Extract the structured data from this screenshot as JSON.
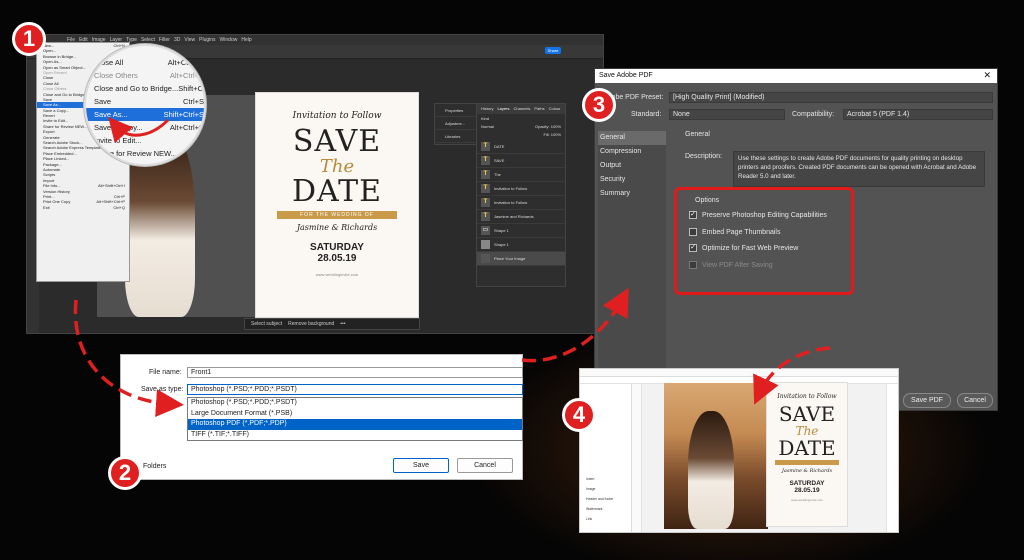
{
  "badges": [
    "1",
    "2",
    "3",
    "4"
  ],
  "accent": "#e02020",
  "ps": {
    "menus": [
      "File",
      "Edit",
      "Image",
      "Layer",
      "Type",
      "Select",
      "Filter",
      "3D",
      "View",
      "Plugins",
      "Window",
      "Help"
    ],
    "share_label": "Share",
    "task_select": "Select subject",
    "task_remove": "Remove background"
  },
  "invite": {
    "sub": "Invitation to Follow",
    "save": "SAVE",
    "the": "The",
    "date": "DATE",
    "band": "FOR THE WEDDING OF",
    "names": "Jasmine & Richards",
    "day": "SATURDAY",
    "num": "28.05.19",
    "url": "www.weddinginvite.com"
  },
  "props_panel": [
    "Properties",
    "Adjustme...",
    "Libraries"
  ],
  "layers_panel": {
    "tabs": [
      "History",
      "Layers",
      "Channels",
      "Paths",
      "Colour"
    ],
    "kind": "Kind",
    "blend": "Normal",
    "opacity": "Opacity: 100%",
    "fill": "Fill: 100%",
    "rows": [
      "DATE",
      "SAVE",
      "The",
      "Invitation to Follow",
      "Invitation to Follow",
      "Jasmine and Richards",
      "Shape 1",
      "Shape 1",
      "Place Your Image"
    ]
  },
  "file_menu": {
    "items": [
      {
        "label": "New...",
        "shortcut": "Ctrl+N"
      },
      {
        "label": "Open...",
        "shortcut": ""
      },
      {
        "label": "Browse in Bridge...",
        "shortcut": ""
      },
      {
        "label": "Open As...",
        "shortcut": ""
      },
      {
        "label": "Open as Smart Object...",
        "shortcut": ""
      },
      {
        "label": "Open Recent",
        "shortcut": ""
      },
      {
        "label": "Close",
        "shortcut": ""
      },
      {
        "label": "Close All",
        "shortcut": ""
      },
      {
        "label": "Close Others",
        "shortcut": ""
      },
      {
        "label": "Close and Go to Bridge...",
        "shortcut": ""
      },
      {
        "label": "Save",
        "shortcut": ""
      },
      {
        "label": "Save As...",
        "shortcut": ""
      },
      {
        "label": "Save a Copy...",
        "shortcut": ""
      },
      {
        "label": "Revert",
        "shortcut": ""
      },
      {
        "label": "Invite to Edit...",
        "shortcut": ""
      },
      {
        "label": "Share for Review NEW...",
        "shortcut": ""
      },
      {
        "label": "Export",
        "shortcut": ""
      },
      {
        "label": "Generate",
        "shortcut": ""
      },
      {
        "label": "Search Adobe Stock...",
        "shortcut": ""
      },
      {
        "label": "Search Adobe Express Templates...",
        "shortcut": ""
      },
      {
        "label": "Place Embedded...",
        "shortcut": ""
      },
      {
        "label": "Place Linked...",
        "shortcut": ""
      },
      {
        "label": "Package...",
        "shortcut": ""
      },
      {
        "label": "Automate",
        "shortcut": ""
      },
      {
        "label": "Scripts",
        "shortcut": ""
      },
      {
        "label": "Import",
        "shortcut": ""
      },
      {
        "label": "File Info...",
        "shortcut": "Alt+Shift+Ctrl+I"
      },
      {
        "label": "Version History",
        "shortcut": ""
      },
      {
        "label": "Print...",
        "shortcut": "Ctrl+P"
      },
      {
        "label": "Print One Copy",
        "shortcut": "Alt+Shift+Ctrl+P"
      },
      {
        "label": "Exit",
        "shortcut": "Ctrl+Q"
      }
    ]
  },
  "magnifier": {
    "items": [
      {
        "label": "Close All",
        "shortcut": "Alt+Ctrl+W"
      },
      {
        "label": "Close Others",
        "shortcut": "Alt+Ctrl+P"
      },
      {
        "label": "Close and Go to Bridge...",
        "shortcut": "Shift+Ctrl+W"
      },
      {
        "label": "Save",
        "shortcut": "Ctrl+S"
      },
      {
        "label": "Save As...",
        "shortcut": "Shift+Ctrl+S"
      },
      {
        "label": "Save a Copy...",
        "shortcut": "Alt+Ctrl+S"
      },
      {
        "label": "Invite to Edit...",
        "shortcut": ""
      },
      {
        "label": "Share for Review NEW...",
        "shortcut": ""
      }
    ]
  },
  "save_dialog": {
    "file_name_label": "File name:",
    "file_name": "Front1",
    "type_label": "Save as type:",
    "type_value": "Photoshop (*.PSD;*.PDD;*.PSDT)",
    "options": [
      "Photoshop (*.PSD;*.PDD;*.PSDT)",
      "Large Document Format (*.PSB)",
      "Photoshop PDF (*.PDF;*.PDP)",
      "TIFF (*.TIF;*.TIFF)"
    ],
    "hide_folders": "Folders",
    "save": "Save",
    "cancel": "Cancel"
  },
  "pdf_dialog": {
    "title": "Save Adobe PDF",
    "preset_label": "Adobe PDF Preset:",
    "preset": "[High Quality Print] (Modified)",
    "standard_label": "Standard:",
    "standard": "None",
    "compat_label": "Compatibility:",
    "compat": "Acrobat 5 (PDF 1.4)",
    "nav": [
      "General",
      "Compression",
      "Output",
      "Security",
      "Summary"
    ],
    "section": "General",
    "desc_label": "Description:",
    "description": "Use these settings to create Adobe PDF documents for quality printing on desktop printers and proofers.  Created PDF documents can be opened with Acrobat and Adobe Reader 5.0 and later.",
    "options_label": "Options",
    "checks": [
      {
        "label": "Preserve Photoshop Editing Capabilities",
        "checked": true
      },
      {
        "label": "Embed Page Thumbnails",
        "checked": false
      },
      {
        "label": "Optimize for Fast Web Preview",
        "checked": true
      },
      {
        "label": "View PDF After Saving",
        "checked": false
      }
    ],
    "save_pdf": "Save PDF",
    "cancel": "Cancel"
  },
  "acrobat": {
    "side_items": [
      "Insert",
      "Image",
      "Header and footer",
      "Watermark",
      "Link"
    ]
  }
}
